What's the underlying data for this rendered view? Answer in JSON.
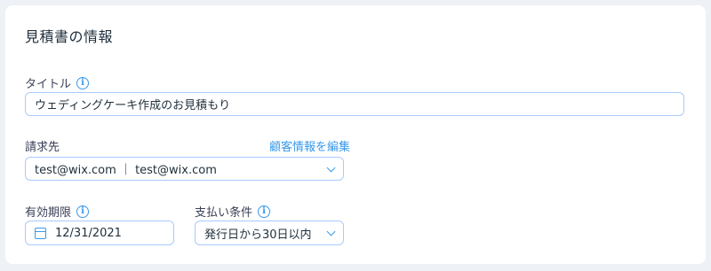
{
  "section": {
    "title": "見積書の情報"
  },
  "title_field": {
    "label": "タイトル",
    "value": "ウェディングケーキ作成のお見積もり"
  },
  "bill_to": {
    "label": "請求先",
    "edit_link": "顧客情報を編集",
    "value": "test@wix.com ｜ test@wix.com"
  },
  "expiry": {
    "label": "有効期限",
    "value": "12/31/2021"
  },
  "payment_terms": {
    "label": "支払い条件",
    "value": "発行日から30日以内"
  },
  "icons": {
    "info": "i",
    "calendar": "calendar-icon",
    "dropdown": "chevron-down-icon"
  },
  "colors": {
    "accent": "#3899ec",
    "input_border": "#a8caff",
    "text": "#20303c"
  }
}
